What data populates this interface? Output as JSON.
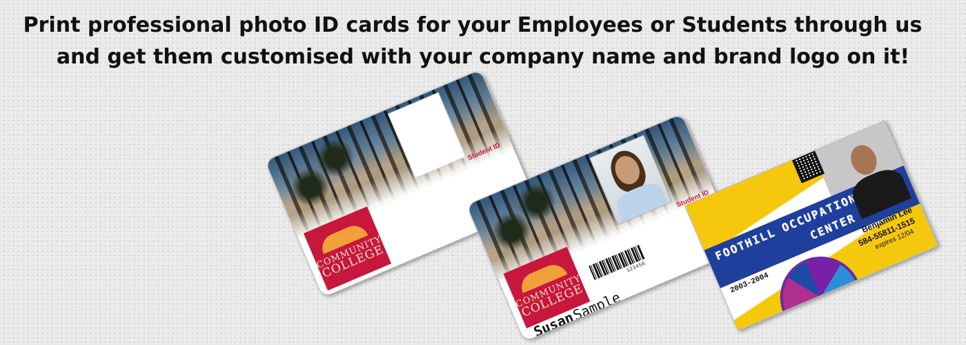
{
  "headline": {
    "line1": "Print professional photo ID cards for your Employees or Students through us",
    "line2": "and get them customised with your company name and brand logo on it!"
  },
  "card1": {
    "logo_line1": "COMMUNITY",
    "logo_line2": "COLLEGE",
    "label": "Student ID"
  },
  "card2": {
    "logo_line1": "COMMUNITY",
    "logo_line2": "COLLEGE",
    "label": "Student ID",
    "barcode_number": "123456",
    "first_name": "Susan",
    "last_name": "Sample"
  },
  "card3": {
    "org_line1": "FOOTHILL OCCUPATIONAL",
    "org_line2": "CENTER",
    "years": "2003-2004",
    "name": "Benjamin Lee",
    "phone": "584-55811-1515",
    "expires": "expires 12/04"
  },
  "colors": {
    "brand_red": "#c8173c",
    "band_blue": "#1f3f9c",
    "card3_yellow": "#f6c80d"
  }
}
